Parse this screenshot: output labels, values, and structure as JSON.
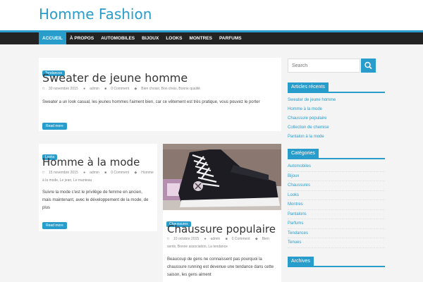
{
  "site": {
    "title": "Homme Fashion"
  },
  "nav": {
    "items": [
      {
        "label": "ACCUEIL"
      },
      {
        "label": "À PROPOS"
      },
      {
        "label": "AUTOMOBILES"
      },
      {
        "label": "BIJOUX"
      },
      {
        "label": "LOOKS"
      },
      {
        "label": "MONTRES"
      },
      {
        "label": "PARFUMS"
      }
    ]
  },
  "posts": [
    {
      "category": "Tendances",
      "title": "Sweater de jeune homme",
      "date": "30 novembre 2015",
      "author": "admin",
      "comments": "0 Comment",
      "tags": "Bien choisir, Bon choix, Bonne qualité",
      "excerpt": "Sweater a un look casual, les jeunes hommes l'aiment bien, car ce vêtement est très pratique, vous pouvez le porter",
      "button": "Read more"
    },
    {
      "category": "Looks",
      "title": "Homme à la mode",
      "date": "15 novembre 2015",
      "author": "admin",
      "comments": "0 Comment",
      "tags_line1": "Homme",
      "tags_line2": "à la mode, Le jean, Le manteau",
      "excerpt": "Suivre la mode c'est le privilège de femme en ancien, mais maintenant, avec le développement de la mode, de plus",
      "button": "Read more"
    },
    {
      "category": "Chaussures",
      "title": "Chaussure populaire",
      "date": "10 octobre 2015",
      "author": "admin",
      "comments": "0 Comment",
      "tags_line1": "Bien",
      "tags_line2": "sentir, Bonne association, La tendance",
      "excerpt": "Beaucoup de gens ne connaissent pas pourquoi la chaussure running est devenue une tendance dans cette saison, les gens aiment"
    }
  ],
  "sidebar": {
    "search_placeholder": "Search",
    "recent_title": "Articles récents",
    "recent": [
      "Sweater de jeune homme",
      "Homme à la mode",
      "Chaussure populaire",
      "Collection de chemise",
      "Pantalon à la mode"
    ],
    "categories_title": "Catégories",
    "categories": [
      "Automobiles",
      "Bijoux",
      "Chaussures",
      "Looks",
      "Montres",
      "Pantalons",
      "Parfums",
      "Tendances",
      "Tenues"
    ],
    "archives_title": "Archives"
  },
  "colors": {
    "accent": "#289dcc",
    "nav_bg": "#232323",
    "page_bg": "#f4f4f4"
  }
}
